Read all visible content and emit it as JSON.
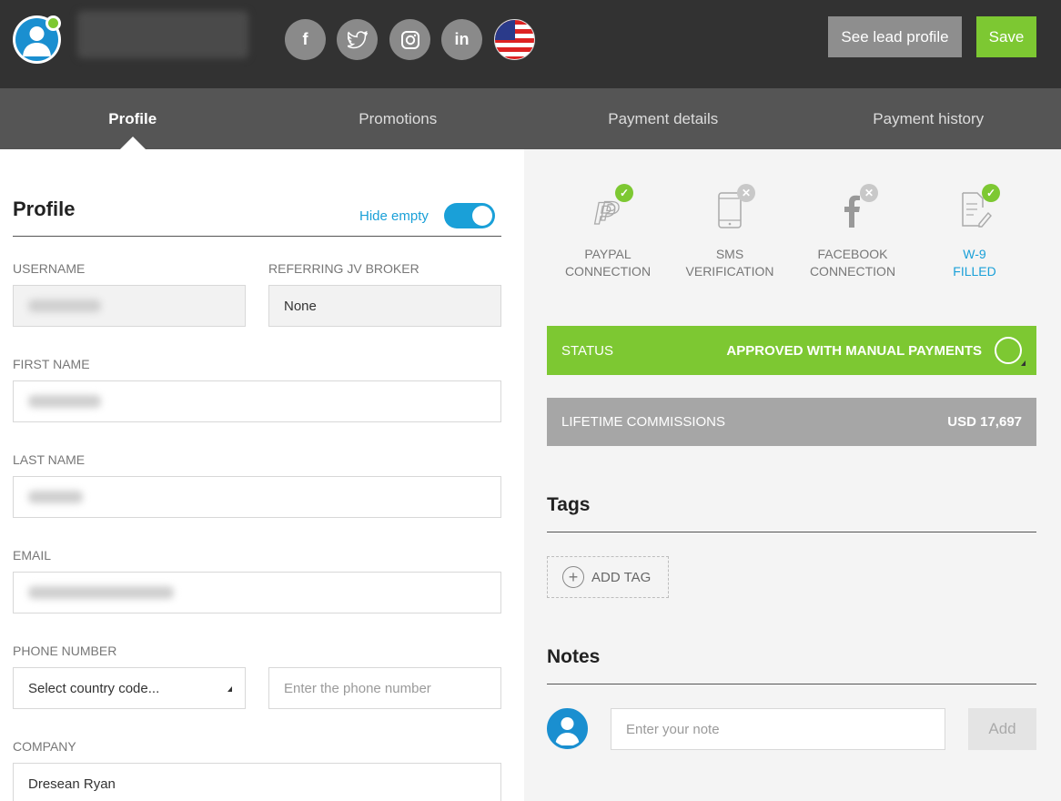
{
  "header": {
    "user_name": "",
    "social": [
      {
        "name": "facebook",
        "glyph": "f"
      },
      {
        "name": "twitter",
        "glyph": "🐦"
      },
      {
        "name": "instagram",
        "glyph": "◎"
      },
      {
        "name": "linkedin",
        "glyph": "in"
      }
    ],
    "country_flag": "us-flag-icon",
    "see_lead_profile_label": "See lead profile",
    "save_label": "Save"
  },
  "tabs": [
    {
      "label": "Profile",
      "active": true
    },
    {
      "label": "Promotions",
      "active": false
    },
    {
      "label": "Payment details",
      "active": false
    },
    {
      "label": "Payment history",
      "active": false
    }
  ],
  "profile": {
    "title": "Profile",
    "hide_empty_label": "Hide empty",
    "hide_empty_on": true,
    "fields": {
      "username_label": "USERNAME",
      "referring_label": "REFERRING JV BROKER",
      "referring_value": "None",
      "first_name_label": "FIRST NAME",
      "last_name_label": "LAST NAME",
      "email_label": "EMAIL",
      "phone_label": "PHONE NUMBER",
      "country_code_value": "Select country code...",
      "phone_placeholder": "Enter the phone number",
      "company_label": "COMPANY",
      "company_value": "Dresean Ryan"
    }
  },
  "verifications": [
    {
      "line1": "PAYPAL",
      "line2": "CONNECTION",
      "ok": true,
      "icon": "paypal-icon"
    },
    {
      "line1": "SMS VERIFICATION",
      "line2": "",
      "ok": false,
      "icon": "phone-icon"
    },
    {
      "line1": "FACEBOOK",
      "line2": "CONNECTION",
      "ok": false,
      "icon": "facebook-icon"
    },
    {
      "line1": "W-9",
      "line2": "FILLED",
      "ok": true,
      "icon": "document-edit-icon"
    }
  ],
  "status": {
    "label": "STATUS",
    "value": "APPROVED WITH MANUAL PAYMENTS"
  },
  "lifetime": {
    "label": "LIFETIME COMMISSIONS",
    "value": "USD 17,697"
  },
  "tags": {
    "title": "Tags",
    "add_label": "ADD TAG"
  },
  "notes": {
    "title": "Notes",
    "placeholder": "Enter your note",
    "add_label": "Add"
  },
  "colors": {
    "accent_green": "#7dc832",
    "accent_blue": "#1aa0d8",
    "topbar": "#323232",
    "tabbar": "#555555"
  }
}
